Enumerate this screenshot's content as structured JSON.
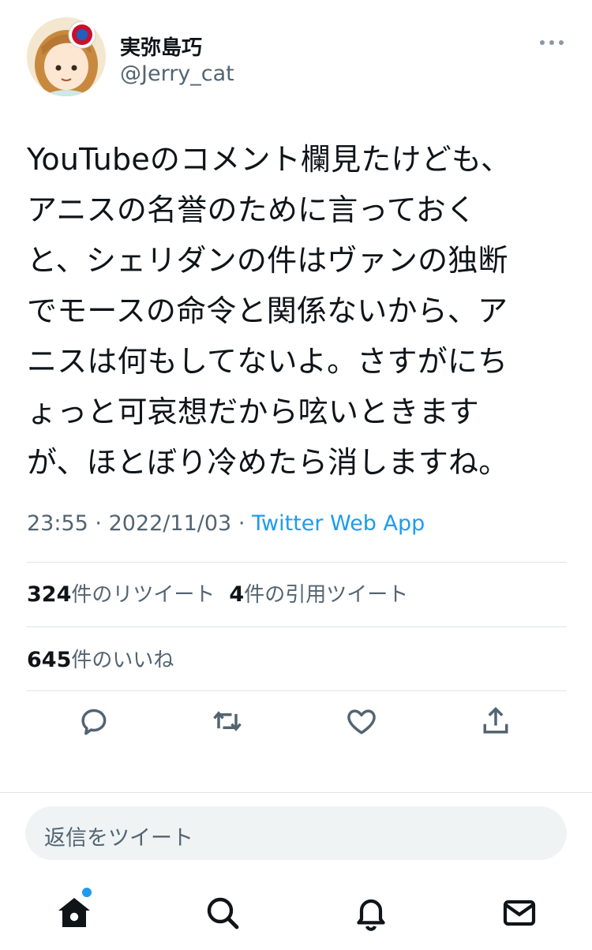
{
  "user": {
    "display_name": "実弥島巧",
    "handle": "@Jerry_cat"
  },
  "tweet": {
    "text": "YouTubeのコメント欄見たけども、\nアニスの名誉のために言っておく\nと、シェリダンの件はヴァンの独断\nでモースの命令と関係ないから、ア\nニスは何もしてないよ。さすがにち\nょっと可哀想だから呟いときます\nが、ほとぼり冷めたら消しますね。",
    "time": "23:55",
    "date": "2022/11/03",
    "separator": "·",
    "source": "Twitter Web App"
  },
  "stats": {
    "retweets_count": "324",
    "retweets_label": "件のリツイート",
    "quotes_count": "4",
    "quotes_label": "件の引用ツイート",
    "likes_count": "645",
    "likes_label": "件のいいね"
  },
  "reply": {
    "placeholder": "返信をツイート"
  },
  "icons": {
    "more": "more-horizontal-icon",
    "reply": "reply-icon",
    "retweet": "retweet-icon",
    "like": "heart-icon",
    "share": "share-icon",
    "home": "home-icon",
    "search": "search-icon",
    "notifications": "bell-icon",
    "messages": "mail-icon"
  },
  "colors": {
    "accent": "#1d9bf0",
    "text": "#0f1419",
    "secondary": "#536471"
  }
}
